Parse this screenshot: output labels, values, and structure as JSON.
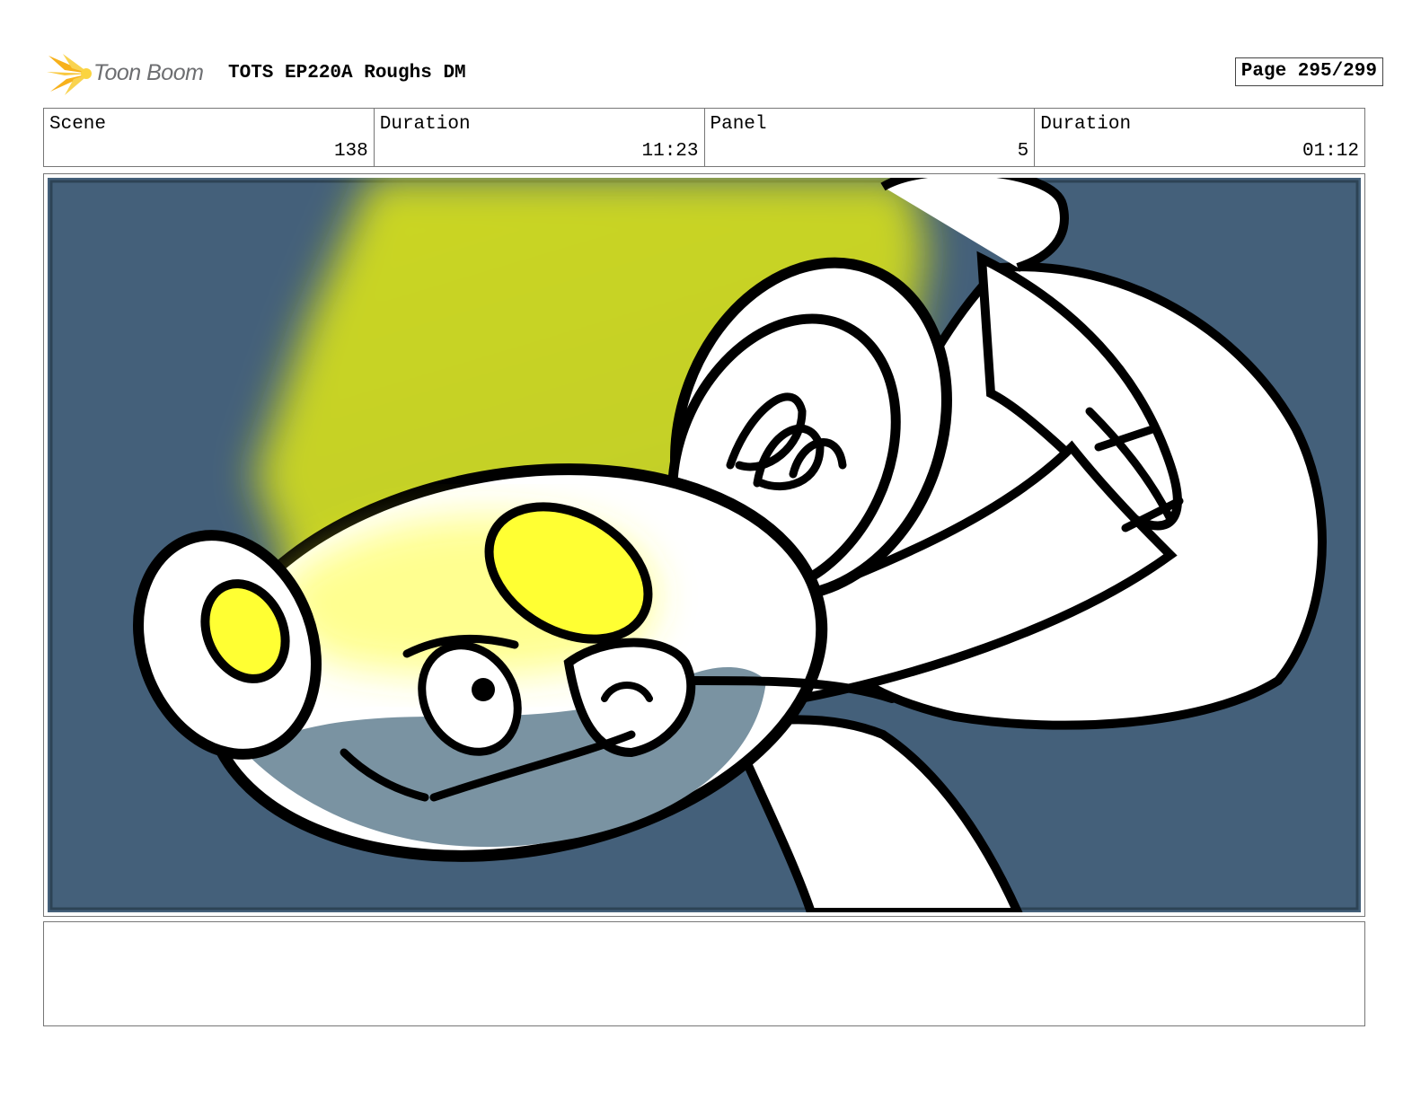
{
  "header": {
    "logo_text": "Toon Boom",
    "title": "TOTS EP220A Roughs DM",
    "page": "Page 295/299"
  },
  "info": [
    {
      "label": "Scene",
      "value": "138"
    },
    {
      "label": "Duration",
      "value": "11:23"
    },
    {
      "label": "Panel",
      "value": "5"
    },
    {
      "label": "Duration",
      "value": "01:12"
    }
  ],
  "panel": {
    "colors": {
      "background": "#44607a",
      "light_beam": "#d2dc1e",
      "highlight": "#ffff33",
      "shadow": "#7a93a2",
      "outline": "#000000",
      "fill": "#ffffff"
    }
  },
  "notes": {
    "text": ""
  }
}
